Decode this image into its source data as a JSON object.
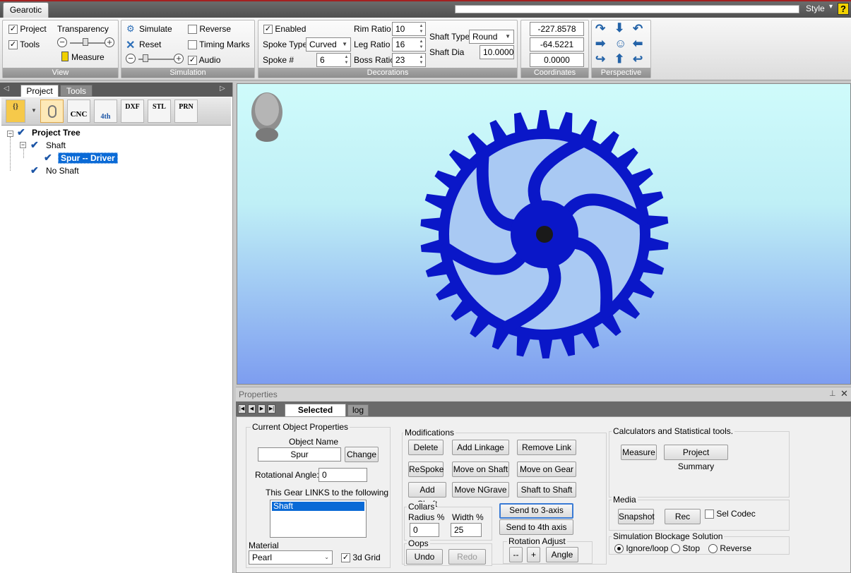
{
  "app": {
    "tab": "Gearotic",
    "style_label": "Style",
    "help": "?"
  },
  "view_group": {
    "title": "View",
    "project_label": "Project",
    "tools_label": "Tools",
    "transparency_label": "Transparency",
    "measure_label": "Measure",
    "minus": "−",
    "plus": "+"
  },
  "simulation_group": {
    "title": "Simulation",
    "simulate_label": "Simulate",
    "reset_label": "Reset",
    "reverse_label": "Reverse",
    "timing_label": "Timing Marks",
    "audio_label": "Audio",
    "minus": "−",
    "plus": "+"
  },
  "decorations_group": {
    "title": "Decorations",
    "enabled_label": "Enabled",
    "spoke_type_label": "Spoke Type",
    "spoke_type_value": "Curved",
    "spoke_count_label": "Spoke #",
    "spoke_count_value": "6",
    "rim_ratio_label": "Rim Ratio",
    "rim_ratio_value": "10",
    "leg_ratio_label": "Leg Ratio",
    "leg_ratio_value": "16",
    "boss_ratio_label": "Boss Ratio",
    "boss_ratio_value": "23",
    "shaft_type_label": "Shaft Type",
    "shaft_type_value": "Round",
    "shaft_dia_label": "Shaft Dia",
    "shaft_dia_value": "10.0000"
  },
  "coordinates_group": {
    "title": "Coordinates",
    "x": "-227.8578",
    "y": "-64.5221",
    "z": "0.0000"
  },
  "perspective_group": {
    "title": "Perspective"
  },
  "left_panel": {
    "tab_project": "Project",
    "tab_tools": "Tools",
    "toolbar": {
      "cnc": "CNC",
      "fourth": "4th",
      "dxf": "DXF",
      "stl": "STL",
      "prn": "PRN",
      "braces": "{}"
    },
    "tree": {
      "root": "Project Tree",
      "shaft": "Shaft",
      "selected": "Spur -- Driver",
      "no_shaft": "No Shaft"
    }
  },
  "gear": {
    "color": "#0a17c8",
    "teeth": 30,
    "spokes": 6
  },
  "properties": {
    "title": "Properties",
    "tab_selected": "Selected Props",
    "tab_log": "log",
    "current_object": {
      "legend": "Current Object Properties",
      "name_label": "Object Name",
      "name_value": "Spur",
      "change_button": "Change",
      "rot_label": "Rotational Angle:",
      "rot_value": "0",
      "links_label": "This Gear LINKS to the following",
      "links": [
        "Shaft"
      ],
      "material_label": "Material",
      "material_value": "Pearl",
      "grid_label": "3d Grid"
    },
    "modifications": {
      "legend": "Modifications",
      "delete": "Delete",
      "add_linkage": "Add Linkage",
      "remove_link": "Remove Link",
      "respoke": "ReSpoke",
      "move_on_shaft": "Move on Shaft",
      "move_on_gear": "Move on Gear",
      "add_shaft": "Add Shaft",
      "move_ngrave": "Move NGrave",
      "shaft_to_shaft": "Shaft to Shaft",
      "send_3axis": "Send to 3-axis",
      "send_4th": "Send to 4th axis"
    },
    "collars": {
      "legend": "Collars",
      "radius_label": "Radius %",
      "radius_value": "0",
      "width_label": "Width %",
      "width_value": "25"
    },
    "oops": {
      "legend": "Oops",
      "undo": "Undo",
      "redo": "Redo"
    },
    "rotation": {
      "legend": "Rotation Adjust",
      "minus": "--",
      "plus": "+",
      "angle": "Angle"
    },
    "calculators": {
      "legend": "Calculators and Statistical tools.",
      "measure": "Measure",
      "summary": "Project Summary"
    },
    "media": {
      "legend": "Media",
      "snapshot": "Snapshot",
      "rec": "Rec",
      "sel_codec": "Sel Codec"
    },
    "blockage": {
      "legend": "Simulation Blockage Solution",
      "ignore": "Ignore/loop",
      "stop": "Stop",
      "reverse": "Reverse"
    }
  }
}
